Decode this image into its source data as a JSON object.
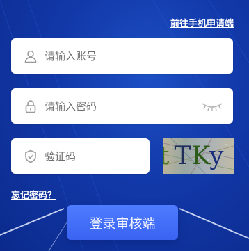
{
  "header": {
    "mobile_apply_link": "前往手机申请端"
  },
  "form": {
    "account": {
      "placeholder": "请输入账号",
      "value": "",
      "icon": "user-icon"
    },
    "password": {
      "placeholder": "请输入密码",
      "value": "",
      "icon": "lock-icon",
      "toggle_icon": "eye-closed-icon"
    },
    "captcha": {
      "placeholder": "验证码",
      "value": "",
      "icon": "shield-icon",
      "image_text": [
        "t",
        "T",
        "K",
        "y"
      ]
    },
    "forgot_link": "忘记密码？",
    "submit_label": "登录审核端"
  },
  "colors": {
    "background": "#1238a8",
    "button": "#3f6bf7",
    "input_bg": "#ffffff",
    "placeholder": "#6f6f6f"
  }
}
